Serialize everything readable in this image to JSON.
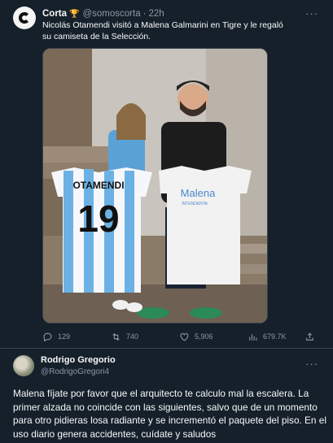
{
  "tweet": {
    "author_name": "Corta",
    "author_badge": "trophy-icon",
    "author_handle": "@somoscorta",
    "separator": "·",
    "time": "22h",
    "text": "Nicolás Otamendi visitó a Malena Galmarini en Tigre y le regaló su camiseta de la Selección.",
    "image": {
      "jersey_left_name": "OTAMENDI",
      "jersey_left_number": "19",
      "tshirt_text": "Malena",
      "tshirt_subtext": "INTENDENTA"
    },
    "actions": {
      "replies": "129",
      "retweets": "740",
      "likes": "5,906",
      "views": "679.7K"
    }
  },
  "reply": {
    "author_name": "Rodrigo Gregorio",
    "author_handle": "@RodrigoGregori4",
    "text": "Malena fíjate por favor que el arquitecto te calculo mal la escalera. La primer alzada no coincide con las siguientes, salvo que de un momento para otro pidieras losa radiante y se incrementó el paquete del piso. En el uso diario genera accidentes, cuídate y saludos"
  },
  "colors": {
    "background": "#15202b",
    "text": "#f7f9f9",
    "muted": "#8b98a5",
    "divider": "#38444d"
  }
}
